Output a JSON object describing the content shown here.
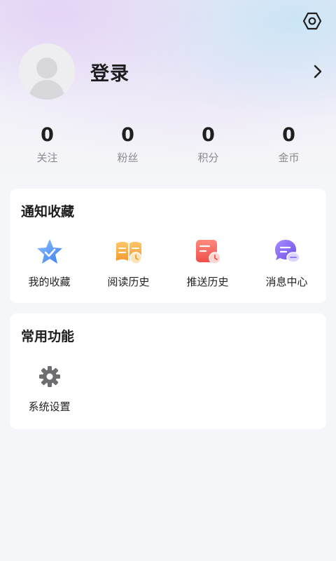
{
  "profile": {
    "login_label": "登录"
  },
  "stats": [
    {
      "value": "0",
      "label": "关注"
    },
    {
      "value": "0",
      "label": "粉丝"
    },
    {
      "value": "0",
      "label": "积分"
    },
    {
      "value": "0",
      "label": "金币"
    }
  ],
  "notify": {
    "title": "通知收藏",
    "items": [
      {
        "label": "我的收藏",
        "icon": "star-icon"
      },
      {
        "label": "阅读历史",
        "icon": "book-clock-icon"
      },
      {
        "label": "推送历史",
        "icon": "calendar-clock-icon"
      },
      {
        "label": "消息中心",
        "icon": "chat-bubble-icon"
      }
    ]
  },
  "common": {
    "title": "常用功能",
    "items": [
      {
        "label": "系统设置",
        "icon": "gear-icon"
      }
    ]
  },
  "colors": {
    "accent_blue": "#4a8ef5",
    "accent_orange": "#f5a23c",
    "accent_red": "#f0605c",
    "accent_purple": "#8a6ef0"
  }
}
